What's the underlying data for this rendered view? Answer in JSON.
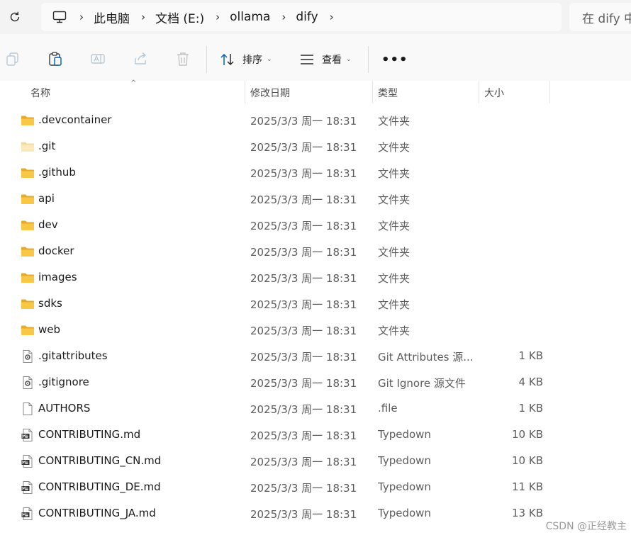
{
  "breadcrumbs": [
    "此电脑",
    "文档 (E:)",
    "ollama",
    "dify"
  ],
  "search": {
    "placeholder": "在 dify 中"
  },
  "toolbar": {
    "sort_label": "排序",
    "view_label": "查看"
  },
  "columns": {
    "name": "名称",
    "date": "修改日期",
    "type": "类型",
    "size": "大小"
  },
  "files": [
    {
      "name": ".devcontainer",
      "date": "2025/3/3 周一 18:31",
      "type": "文件夹",
      "size": "",
      "icon": "folder-icon"
    },
    {
      "name": ".git",
      "date": "2025/3/3 周一 18:31",
      "type": "文件夹",
      "size": "",
      "icon": "folder-hidden-icon"
    },
    {
      "name": ".github",
      "date": "2025/3/3 周一 18:31",
      "type": "文件夹",
      "size": "",
      "icon": "folder-icon"
    },
    {
      "name": "api",
      "date": "2025/3/3 周一 18:31",
      "type": "文件夹",
      "size": "",
      "icon": "folder-icon"
    },
    {
      "name": "dev",
      "date": "2025/3/3 周一 18:31",
      "type": "文件夹",
      "size": "",
      "icon": "folder-icon"
    },
    {
      "name": "docker",
      "date": "2025/3/3 周一 18:31",
      "type": "文件夹",
      "size": "",
      "icon": "folder-icon"
    },
    {
      "name": "images",
      "date": "2025/3/3 周一 18:31",
      "type": "文件夹",
      "size": "",
      "icon": "folder-icon"
    },
    {
      "name": "sdks",
      "date": "2025/3/3 周一 18:31",
      "type": "文件夹",
      "size": "",
      "icon": "folder-icon"
    },
    {
      "name": "web",
      "date": "2025/3/3 周一 18:31",
      "type": "文件夹",
      "size": "",
      "icon": "folder-icon"
    },
    {
      "name": ".gitattributes",
      "date": "2025/3/3 周一 18:31",
      "type": "Git Attributes 源...",
      "size": "1 KB",
      "icon": "config-file-icon"
    },
    {
      "name": ".gitignore",
      "date": "2025/3/3 周一 18:31",
      "type": "Git Ignore 源文件",
      "size": "4 KB",
      "icon": "config-file-icon"
    },
    {
      "name": "AUTHORS",
      "date": "2025/3/3 周一 18:31",
      "type": ".file",
      "size": "1 KB",
      "icon": "file-icon"
    },
    {
      "name": "CONTRIBUTING.md",
      "date": "2025/3/3 周一 18:31",
      "type": "Typedown",
      "size": "10 KB",
      "icon": "markdown-file-icon"
    },
    {
      "name": "CONTRIBUTING_CN.md",
      "date": "2025/3/3 周一 18:31",
      "type": "Typedown",
      "size": "10 KB",
      "icon": "markdown-file-icon"
    },
    {
      "name": "CONTRIBUTING_DE.md",
      "date": "2025/3/3 周一 18:31",
      "type": "Typedown",
      "size": "11 KB",
      "icon": "markdown-file-icon"
    },
    {
      "name": "CONTRIBUTING_JA.md",
      "date": "2025/3/3 周一 18:31",
      "type": "Typedown",
      "size": "13 KB",
      "icon": "markdown-file-icon"
    }
  ],
  "watermark": "CSDN @正经教主",
  "colors": {
    "folder": "#f7c745",
    "folder_dark": "#e6a92a",
    "accent": "#005fb8"
  }
}
